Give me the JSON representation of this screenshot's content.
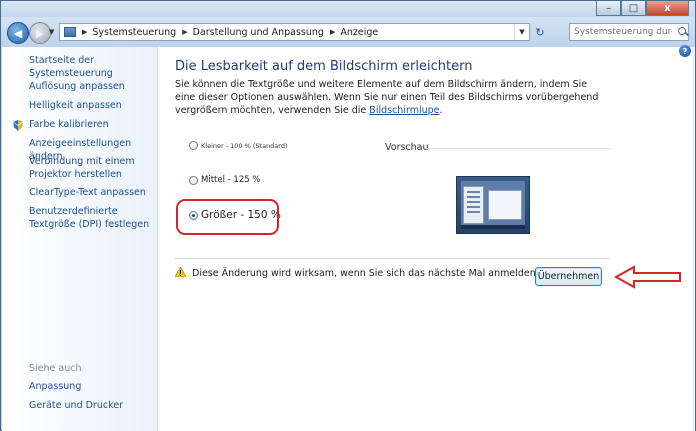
{
  "window": {
    "buttons": {
      "minimize": "–",
      "maximize": "□",
      "close": "x"
    }
  },
  "nav": {
    "back_glyph": "◀",
    "forward_glyph": "▶",
    "breadcrumbs": [
      "Systemsteuerung",
      "Darstellung und Anpassung",
      "Anzeige"
    ],
    "search_placeholder": "Systemsteuerung durch...",
    "refresh_glyph": "↻"
  },
  "sidebar": {
    "home": "Startseite der Systemsteuerung",
    "items": [
      {
        "label": "Auflösung anpassen"
      },
      {
        "label": "Helligkeit anpassen"
      },
      {
        "label": "Farbe kalibrieren",
        "icon": "shield-icon"
      },
      {
        "label": "Anzeigeeinstellungen ändern"
      },
      {
        "label": "Verbindung mit einem Projektor herstellen"
      },
      {
        "label": "ClearType-Text anpassen"
      },
      {
        "label": "Benutzerdefinierte Textgröße (DPI) festlegen"
      }
    ],
    "see_also_header": "Siehe auch",
    "see_also": [
      {
        "label": "Anpassung"
      },
      {
        "label": "Geräte und Drucker"
      }
    ]
  },
  "main": {
    "help_glyph": "?",
    "title": "Die Lesbarkeit auf dem Bildschirm erleichtern",
    "description": "Sie können die Textgröße und weitere Elemente auf dem Bildschirm ändern, indem Sie eine dieser Optionen auswählen. Wenn Sie nur einen Teil des Bildschirms vorübergehend vergrößern möchten, verwenden Sie die ",
    "description_link": "Bildschirmlupe",
    "description_end": ".",
    "options": [
      {
        "label": "Kleiner - 100 % (Standard)",
        "checked": false
      },
      {
        "label": "Mittel - 125 %",
        "checked": false
      },
      {
        "label": "Größer - 150 %",
        "checked": true
      }
    ],
    "preview_label": "Vorschau",
    "warning_text": "Diese Änderung wird wirksam, wenn Sie sich das nächste Mal anmelden.",
    "apply_label": "Übernehmen"
  },
  "colors": {
    "link": "#1b4f95",
    "title": "#1c3d7a",
    "annotation_red": "#d2272a"
  }
}
